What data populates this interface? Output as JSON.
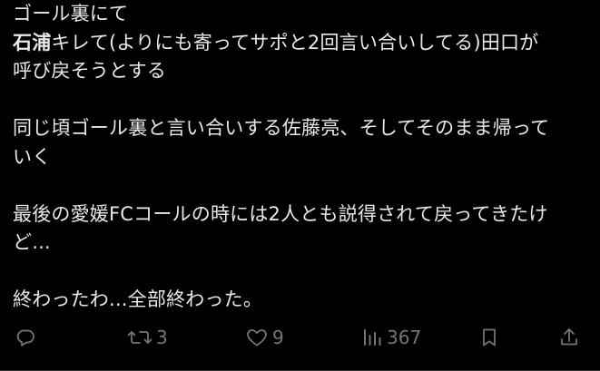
{
  "tweet": {
    "line1": "ゴール裏にて",
    "line2_mention": "石浦",
    "line2_rest": "キレて(よりにも寄ってサポと2回言い合いしてる)田口が",
    "line3": "呼び戻そうとする",
    "line4": "同じ頃ゴール裏と言い合いする佐藤亮、そしてそのまま帰って",
    "line5": "いく",
    "line6": "最後の愛媛FCコールの時には2人とも説得されて戻ってきたけ",
    "line7": "ど...",
    "line8": "終わったわ...全部終わった。"
  },
  "actions": {
    "reply_icon": "reply-icon",
    "retweet_icon": "retweet-icon",
    "retweet_count": "3",
    "like_icon": "heart-icon",
    "like_count": "9",
    "views_icon": "views-bar-chart-icon",
    "views_count": "367",
    "bookmark_icon": "bookmark-icon",
    "share_icon": "share-icon"
  },
  "colors": {
    "background": "#000000",
    "text": "#e7e9ea",
    "muted": "#71767b"
  }
}
